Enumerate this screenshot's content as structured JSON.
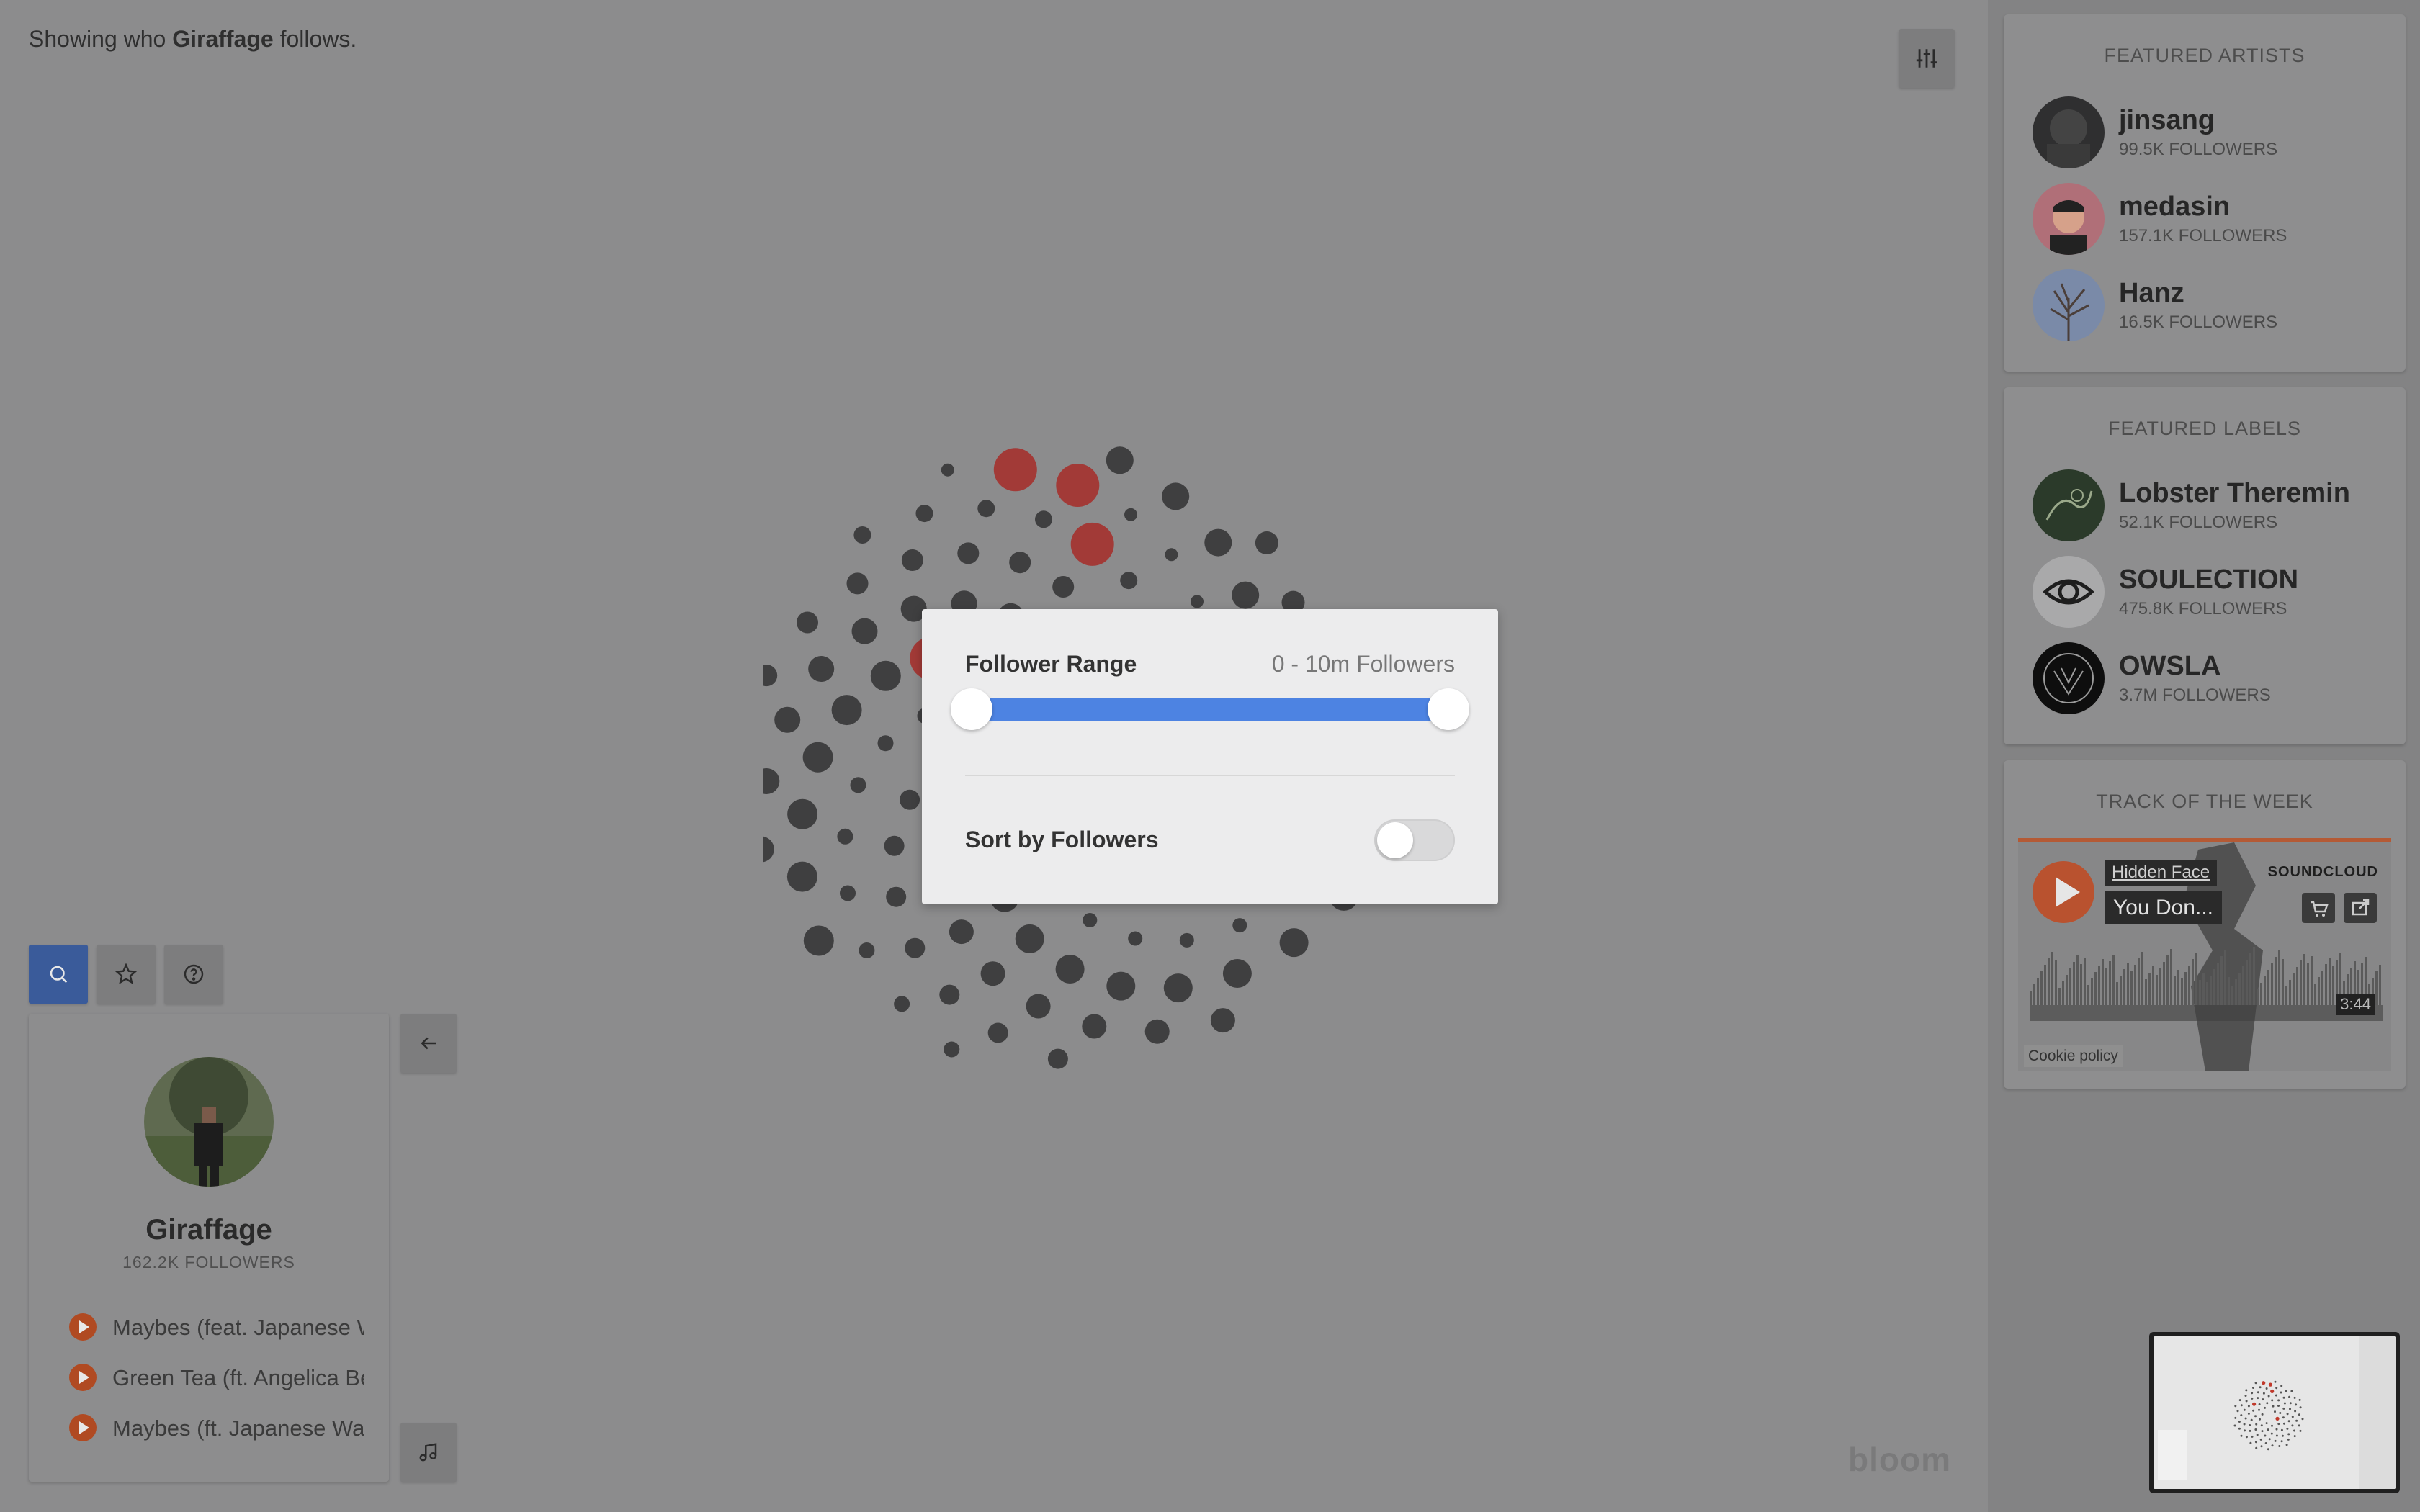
{
  "caption": {
    "prefix": "Showing who",
    "user": "Giraffage",
    "suffix": "follows."
  },
  "icons": {
    "filter": "sliders-icon",
    "search": "search-icon",
    "favorites": "star-icon",
    "help": "help-icon",
    "back": "arrow-left-icon",
    "music": "music-note-icon"
  },
  "featured_artists": {
    "title": "FEATURED ARTISTS",
    "items": [
      {
        "name": "jinsang",
        "followers": "99.5K FOLLOWERS"
      },
      {
        "name": "medasin",
        "followers": "157.1K FOLLOWERS"
      },
      {
        "name": "Hanz",
        "followers": "16.5K FOLLOWERS"
      }
    ]
  },
  "featured_labels": {
    "title": "FEATURED LABELS",
    "items": [
      {
        "name": "Lobster Theremin",
        "followers": "52.1K FOLLOWERS"
      },
      {
        "name": "SOULECTION",
        "followers": "475.8K FOLLOWERS"
      },
      {
        "name": "OWSLA",
        "followers": "3.7M FOLLOWERS"
      }
    ]
  },
  "track_of_week": {
    "title": "TRACK OF THE WEEK",
    "artist": "Hidden Face",
    "track": "You Don...",
    "logo": "SOUNDCLOUD",
    "duration": "3:44",
    "cookie": "Cookie policy"
  },
  "profile": {
    "name": "Giraffage",
    "followers": "162.2K FOLLOWERS",
    "tracks": [
      "Maybes (feat. Japanese Wallpaper)",
      "Green Tea (ft. Angelica Bess)",
      "Maybes (ft. Japanese Wallpaper)"
    ]
  },
  "modal": {
    "range_label": "Follower Range",
    "range_value": "0 - 10m Followers",
    "range_fraction": {
      "min": 0.0,
      "max": 1.0
    },
    "sort_label": "Sort by Followers",
    "sort_enabled": false
  },
  "brand": "bloom",
  "colors": {
    "accent_blue": "#4d83e2",
    "highlight_red": "#a23a37",
    "node_dark": "#3f3f40",
    "play_orange": "#b04a22"
  }
}
